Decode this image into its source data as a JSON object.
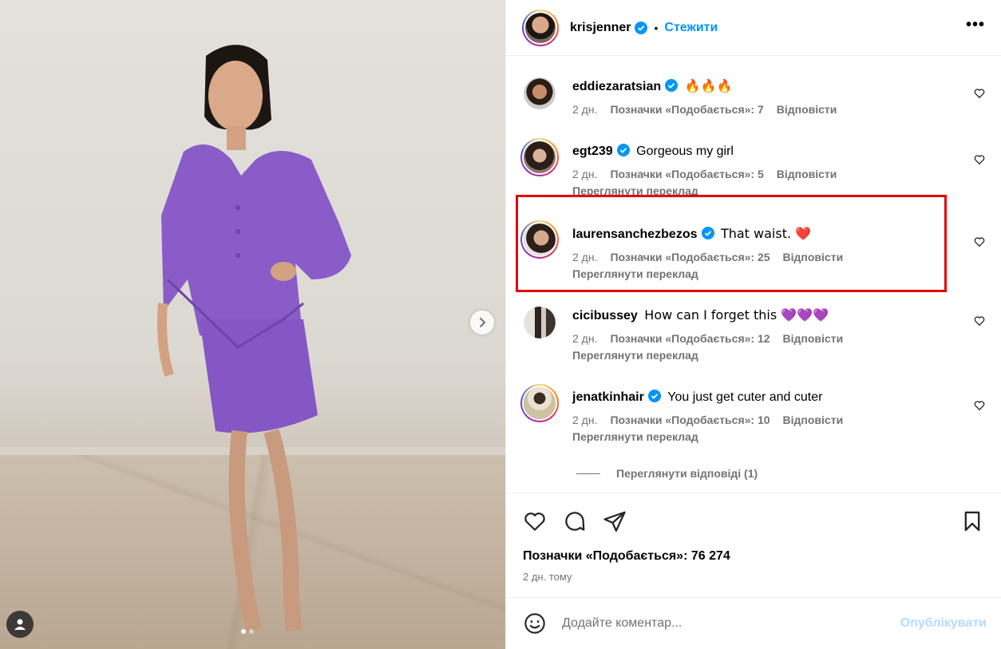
{
  "post": {
    "author": "krisjenner",
    "follow_label": "Стежити",
    "separator": "•",
    "more_label": "•••"
  },
  "media": {
    "slide_count": 2,
    "active_slide": 1
  },
  "comments": [
    {
      "username": "eddiezaratsian",
      "verified": true,
      "text": "🔥🔥🔥",
      "age": "2 дн.",
      "likes": "Позначки «Подобається»: 7",
      "reply": "Відповісти",
      "translate": ""
    },
    {
      "username": "egt239",
      "verified": true,
      "text": "Gorgeous my girl",
      "age": "2 дн.",
      "likes": "Позначки «Подобається»: 5",
      "reply": "Відповісти",
      "translate": "Переглянути переклад"
    },
    {
      "username": "laurensanchezbezos",
      "verified": true,
      "text": "That waist. ❤️",
      "age": "2 дн.",
      "likes": "Позначки «Подобається»: 25",
      "reply": "Відповісти",
      "translate": "Переглянути переклад"
    },
    {
      "username": "cicibussey",
      "verified": false,
      "text": "How can I forget this 💜💜💜",
      "age": "2 дн.",
      "likes": "Позначки «Подобається»: 12",
      "reply": "Відповісти",
      "translate": "Переглянути переклад"
    },
    {
      "username": "jenatkinhair",
      "verified": true,
      "text": "You just get cuter and cuter",
      "age": "2 дн.",
      "likes": "Позначки «Подобається»: 10",
      "reply": "Відповісти",
      "translate": "Переглянути переклад"
    }
  ],
  "view_replies": "Переглянути відповіді (1)",
  "likes_total": "Позначки «Подобається»: 76 274",
  "posted_ago": "2 дн. тому",
  "add_comment": {
    "placeholder": "Додайте коментар...",
    "publish_label": "Опублікувати"
  },
  "colors": {
    "accent_blue": "#0095f6",
    "publish_disabled": "#b3dbff",
    "highlight_red": "#e60000",
    "suit_purple": "#8a5cc8"
  }
}
